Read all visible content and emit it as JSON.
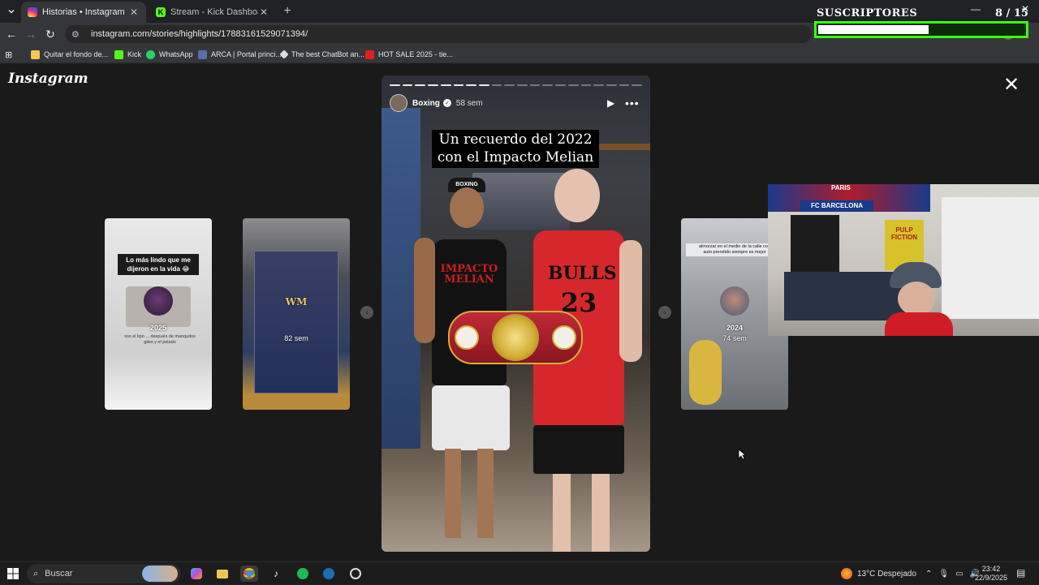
{
  "browser": {
    "tabs": [
      {
        "title": "Historias • Instagram",
        "active": true,
        "color": "#e1306c"
      },
      {
        "title": "Stream - Kick Dashboard",
        "active": false,
        "color": "#53fc18"
      }
    ],
    "url": "instagram.com/stories/highlights/17883161529071394/",
    "bookmarks": [
      {
        "label": "Quitar el fondo de...",
        "color": "#f2c94c"
      },
      {
        "label": "Kick",
        "color": "#53fc18"
      },
      {
        "label": "WhatsApp",
        "color": "#25d366"
      },
      {
        "label": "ARCA | Portal princi...",
        "color": "#5a6ea8"
      },
      {
        "label": "The best ChatBot an...",
        "color": "#dddddd"
      },
      {
        "label": "HOT SALE 2025 - tie...",
        "color": "#e02020"
      }
    ]
  },
  "instagram": {
    "logo": "Instagram",
    "previews": [
      {
        "year": "2025",
        "title_lines": [
          "Lo más lindo que me",
          "dijeron en la vida 😂"
        ],
        "body": "sos el tipo ... después de manquitos giles y el pelado"
      },
      {
        "age": "82 sem"
      },
      {
        "year": "2024",
        "age": "74 sem",
        "title_lines": [
          "almorzar en el medio de la calle con",
          "auto prendido siempre es mejor"
        ]
      }
    ],
    "story": {
      "username": "Boxing",
      "age": "58 sem",
      "caption_lines": [
        "Un recuerdo del 2022",
        "con el Impacto Melian"
      ],
      "progress_total": 20,
      "progress_done": 8,
      "shirt_text_1": "IMPACTO MELIAN",
      "shirt_text_2": "BULLS",
      "shirt_number": "23",
      "cap_text": "BOXING"
    }
  },
  "overlay": {
    "subs_label": "SUSCRIPTORES",
    "subs_count": "8 / 15",
    "subs_progress": 0.53,
    "bar_color": "#39ff14",
    "webcam_signs": [
      "PARIS",
      "FC BARCELONA",
      "PULP FICTION"
    ]
  },
  "taskbar": {
    "search_placeholder": "Buscar",
    "weather": "13°C  Despejado",
    "time": "23:42",
    "date": "22/9/2025"
  }
}
